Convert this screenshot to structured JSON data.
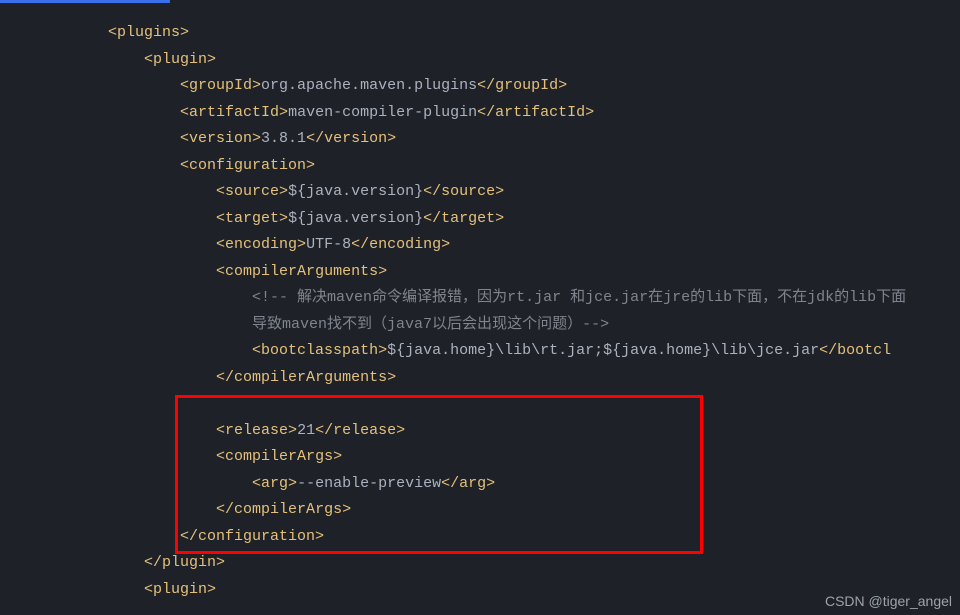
{
  "code": {
    "l1": {
      "tag_open": "<plugins>",
      "indent": "            "
    },
    "l2": {
      "tag_open": "<plugin>",
      "indent": "                "
    },
    "l3": {
      "open": "<groupId>",
      "val": "org.apache.maven.plugins",
      "close": "</groupId>",
      "indent": "                    "
    },
    "l4": {
      "open": "<artifactId>",
      "val": "maven-compiler-plugin",
      "close": "</artifactId>",
      "indent": "                    "
    },
    "l5": {
      "open": "<version>",
      "val": "3.8.1",
      "close": "</version>",
      "indent": "                    "
    },
    "l6": {
      "tag_open": "<configuration>",
      "indent": "                    "
    },
    "l7": {
      "open": "<source>",
      "val": "${java.version}",
      "close": "</source>",
      "indent": "                        "
    },
    "l8": {
      "open": "<target>",
      "val": "${java.version}",
      "close": "</target>",
      "indent": "                        "
    },
    "l9": {
      "open": "<encoding>",
      "val": "UTF-8",
      "close": "</encoding>",
      "indent": "                        "
    },
    "l10": {
      "tag_open": "<compilerArguments>",
      "indent": "                        "
    },
    "l11": {
      "comment": "<!-- 解决maven命令编译报错，因为rt.jar 和jce.jar在jre的lib下面，不在jdk的lib下面",
      "indent": "                            "
    },
    "l12": {
      "comment": "导致maven找不到（java7以后会出现这个问题）-->",
      "indent": "                            "
    },
    "l13": {
      "open": "<bootclasspath>",
      "val": "${java.home}\\lib\\rt.jar;${java.home}\\lib\\jce.jar",
      "close": "</bootcl",
      "indent": "                            "
    },
    "l14": {
      "tag_close": "</compilerArguments>",
      "indent": "                        "
    },
    "l15": {
      "indent": "                        "
    },
    "l16": {
      "open": "<release>",
      "val": "21",
      "close": "</release>",
      "indent": "                        "
    },
    "l17": {
      "tag_open": "<compilerArgs>",
      "indent": "                        "
    },
    "l18": {
      "open": "<arg>",
      "val": "--enable-preview",
      "close": "</arg>",
      "indent": "                            "
    },
    "l19": {
      "tag_close": "</compilerArgs>",
      "indent": "                        "
    },
    "l20": {
      "tag_close": "</configuration>",
      "indent": "                    "
    },
    "l21": {
      "tag_close": "</plugin>",
      "indent": "                "
    },
    "l22": {
      "tag_open": "<plugin>",
      "indent": "                "
    }
  },
  "watermark": "CSDN @tiger_angel"
}
